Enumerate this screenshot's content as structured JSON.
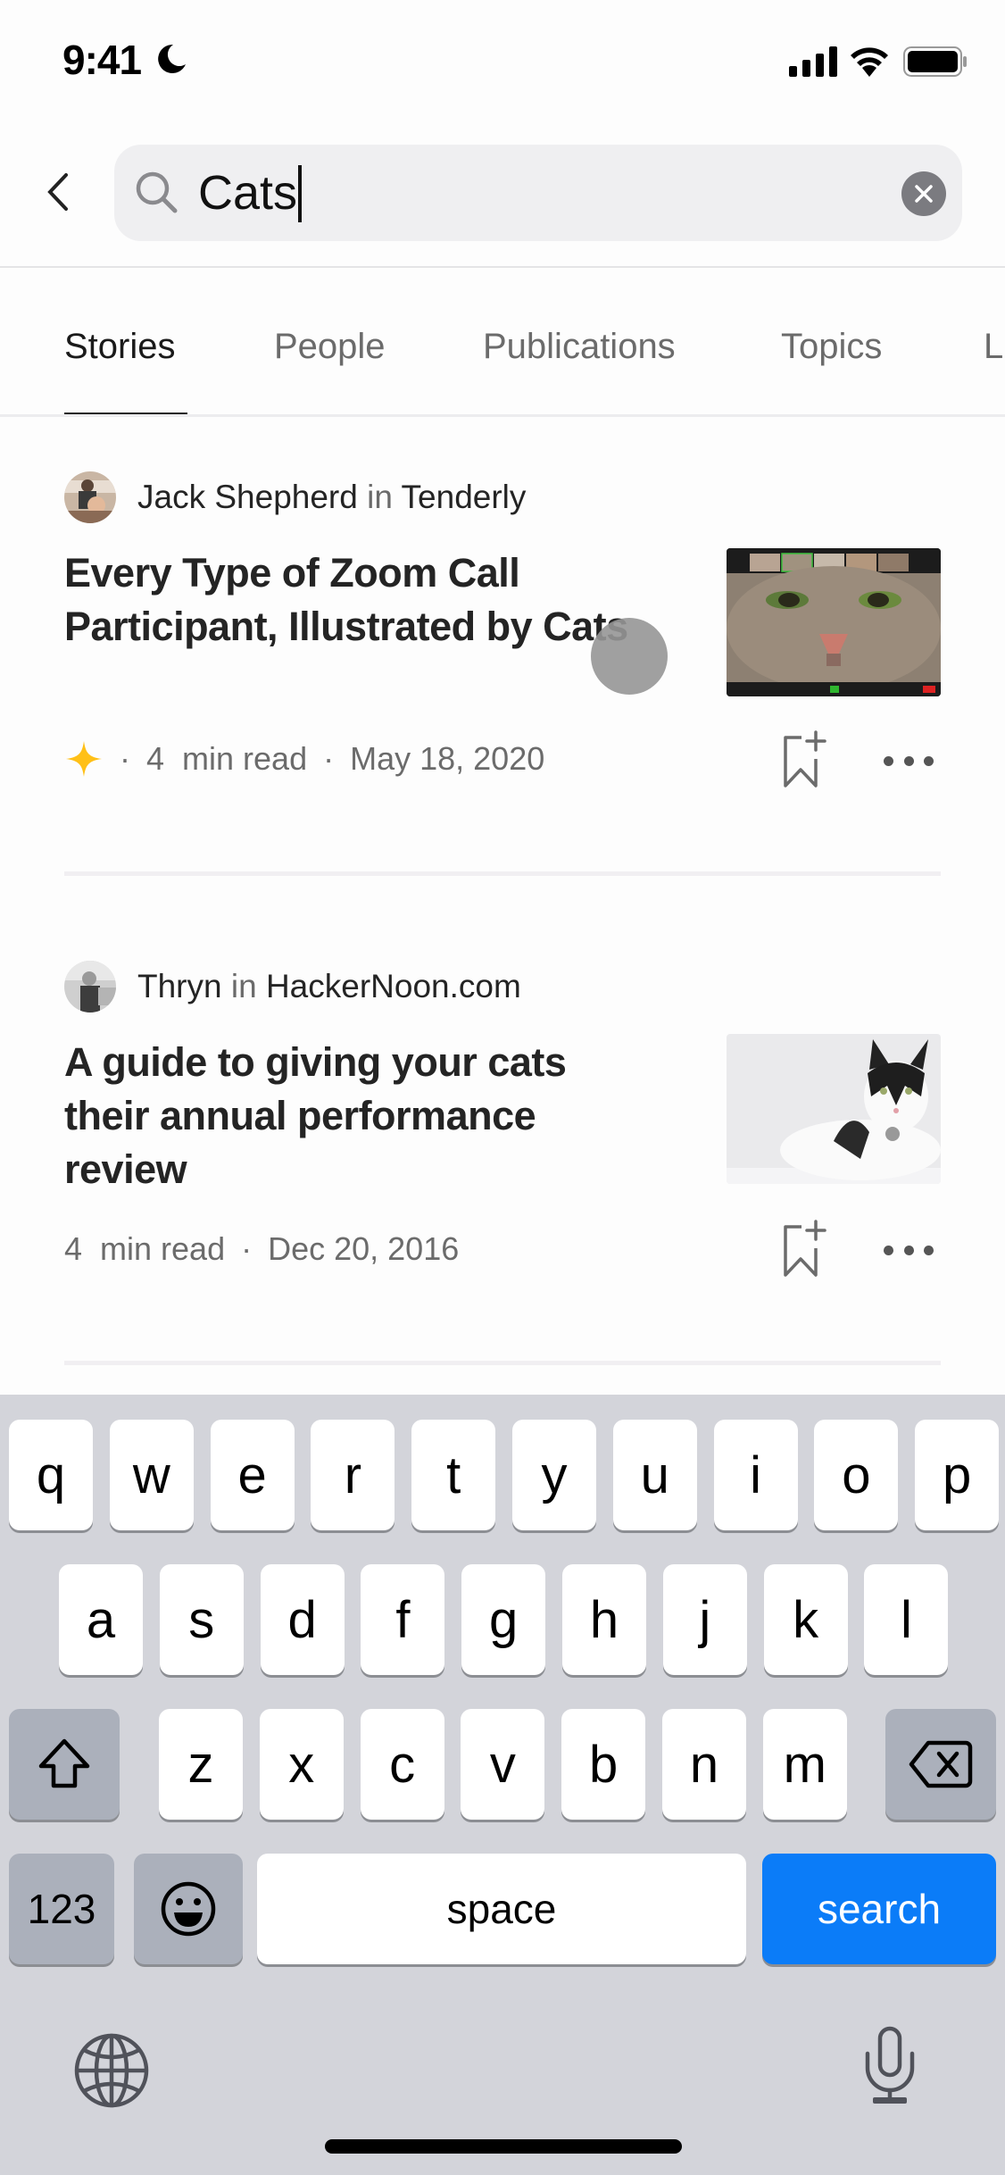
{
  "status_bar": {
    "time": "9:41",
    "focus_icon": "moon-icon",
    "icons": [
      "cellular-signal-icon",
      "wifi-icon",
      "battery-icon"
    ]
  },
  "search": {
    "back_icon": "chevron-left-icon",
    "search_icon": "magnifier-icon",
    "value": "Cats",
    "clear_icon": "clear-x-icon"
  },
  "tabs": [
    {
      "label": "Stories",
      "active": true
    },
    {
      "label": "People",
      "active": false
    },
    {
      "label": "Publications",
      "active": false
    },
    {
      "label": "Topics",
      "active": false
    },
    {
      "label": "L",
      "active": false
    }
  ],
  "stories": [
    {
      "author": "Jack Shepherd",
      "in_word": "in",
      "publication": "Tenderly",
      "title_line1": "Every Type of Zoom Call",
      "title_line2": "Participant, Illustrated by Cats",
      "member_only": true,
      "member_icon": "sparkle-star-icon",
      "read_time": "4  min read",
      "date": "May 18, 2020",
      "thumbnail": "cat-face-zoom-call-image",
      "accent_color": "#ffc017"
    },
    {
      "author": "Thryn",
      "in_word": "in",
      "publication": "HackerNoon.com",
      "title_line1": "A guide to giving your cats",
      "title_line2": "their annual performance",
      "title_line3": "review",
      "member_only": false,
      "read_time": "4  min read",
      "date": "Dec 20, 2016",
      "thumbnail": "black-white-cat-image"
    }
  ],
  "meta_separator": "·",
  "keyboard": {
    "row1": [
      "q",
      "w",
      "e",
      "r",
      "t",
      "y",
      "u",
      "i",
      "o",
      "p"
    ],
    "row2": [
      "a",
      "s",
      "d",
      "f",
      "g",
      "h",
      "j",
      "k",
      "l"
    ],
    "row3": [
      "z",
      "x",
      "c",
      "v",
      "b",
      "n",
      "m"
    ],
    "shift_icon": "shift-arrow-icon",
    "delete_icon": "backspace-icon",
    "numbers_label": "123",
    "emoji_icon": "emoji-smile-icon",
    "space_label": "space",
    "search_label": "search",
    "globe_icon": "globe-icon",
    "mic_icon": "microphone-icon",
    "primary_color": "#0b7cf8"
  }
}
